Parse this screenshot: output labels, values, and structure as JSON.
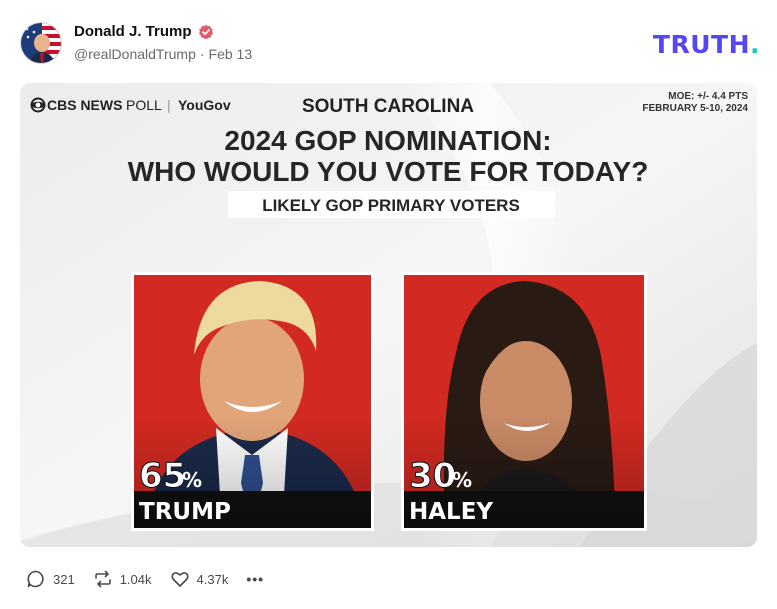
{
  "post": {
    "author": {
      "display_name": "Donald J. Trump",
      "handle": "@realDonaldTrump",
      "separator": "·",
      "date": "Feb 13",
      "verified_icon": "verified-badge-icon"
    },
    "platform_logo": {
      "text": "TRUTH",
      "dot": ".",
      "color": "#5448ee",
      "dot_color": "#1fc7c3"
    },
    "graphic": {
      "source_cbs": "CBS NEWS",
      "source_poll": "POLL",
      "source_divider": "|",
      "source_yougov": "YouGov",
      "state": "SOUTH CAROLINA",
      "moe": "MOE: +/- 4.4 PTS",
      "dates": "FEBRUARY 5-10, 2024",
      "title_line1": "2024 GOP NOMINATION:",
      "title_line2": "WHO WOULD YOU VOTE FOR TODAY?",
      "subtitle": "LIKELY GOP PRIMARY VOTERS",
      "accent_color": "#d22a22",
      "candidates": [
        {
          "pct_number": "65",
          "pct_sign": "%",
          "name": "TRUMP"
        },
        {
          "pct_number": "30",
          "pct_sign": "%",
          "name": "HALEY"
        }
      ]
    },
    "actions": {
      "replies": "321",
      "retruths": "1.04k",
      "likes": "4.37k",
      "more": "•••",
      "icons": [
        "reply-icon",
        "retruth-icon",
        "like-icon",
        "more-icon"
      ]
    }
  }
}
